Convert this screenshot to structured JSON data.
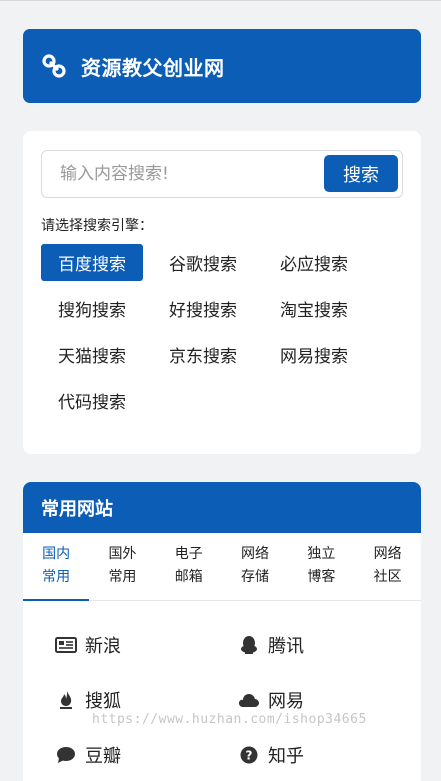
{
  "header": {
    "title": "资源教父创业网",
    "logo_icon": "link-icon"
  },
  "search": {
    "placeholder": "输入内容搜索!",
    "button_label": "搜索",
    "engine_prompt": "请选择搜索引擎：",
    "engines": [
      "百度搜索",
      "谷歌搜索",
      "必应搜索",
      "搜狗搜索",
      "好搜搜索",
      "淘宝搜索",
      "天猫搜索",
      "京东搜索",
      "网易搜索",
      "代码搜索"
    ],
    "active_engine": "百度搜索"
  },
  "sites": {
    "title": "常用网站",
    "tabs": [
      {
        "line1": "国内",
        "line2": "常用"
      },
      {
        "line1": "国外",
        "line2": "常用"
      },
      {
        "line1": "电子",
        "line2": "邮箱"
      },
      {
        "line1": "网络",
        "line2": "存储"
      },
      {
        "line1": "独立",
        "line2": "博客"
      },
      {
        "line1": "网络",
        "line2": "社区"
      }
    ],
    "links": [
      {
        "label": "新浪",
        "icon": "newspaper-icon"
      },
      {
        "label": "腾讯",
        "icon": "qq-penguin-icon"
      },
      {
        "label": "搜狐",
        "icon": "fire-icon"
      },
      {
        "label": "网易",
        "icon": "cloud-icon"
      },
      {
        "label": "豆瓣",
        "icon": "chat-bubble-icon"
      },
      {
        "label": "知乎",
        "icon": "question-circle-icon"
      }
    ]
  },
  "watermark": "https://www.huzhan.com/ishop34665",
  "colors": {
    "primary": "#0c5db6",
    "background": "#f1f2f4"
  }
}
